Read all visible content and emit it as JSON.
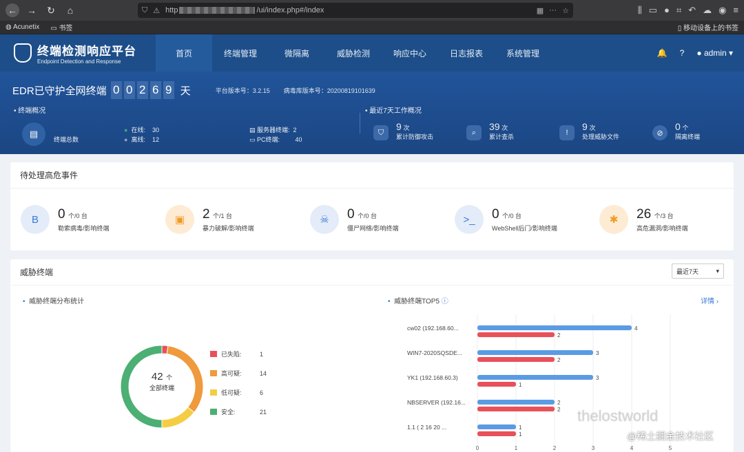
{
  "browser": {
    "url_prefix": "http",
    "url_suffix": "/ui/index.php#/index",
    "bookmark_1": "Acunetix",
    "bookmark_2": "书签",
    "bookmark_right": "移动设备上的书签"
  },
  "nav": {
    "title": "终端检测响应平台",
    "subtitle": "Endpoint Detection and Response",
    "items": [
      "首页",
      "终端管理",
      "微隔离",
      "威胁检测",
      "响应中心",
      "日志报表",
      "系统管理"
    ],
    "user": "admin"
  },
  "hero": {
    "guard_text": "EDR已守护全网终端",
    "days": [
      "0",
      "0",
      "2",
      "6",
      "9"
    ],
    "day_unit": "天",
    "platform_version": "平台版本号：3.2.15",
    "virus_version": "病毒库版本号：20200819101639",
    "overview_title": "终端概况",
    "total_label": "终端总数",
    "online_label": "在线:",
    "online": "30",
    "offline_label": "离线:",
    "offline": "12",
    "server_label": "服务器终端:",
    "server": "2",
    "pc_label": "PC终端:",
    "pc": "40",
    "week_title": "最近7天工作概况",
    "week": [
      {
        "value": "9",
        "unit": "次",
        "label": "累计防御攻击"
      },
      {
        "value": "39",
        "unit": "次",
        "label": "累计查杀"
      },
      {
        "value": "9",
        "unit": "次",
        "label": "处理威胁文件"
      },
      {
        "value": "0",
        "unit": "个",
        "label": "隔离终端"
      }
    ]
  },
  "pending": {
    "title": "待处理高危事件",
    "items": [
      {
        "value": "0",
        "unit": "个/0 台",
        "label": "勒索病毒/影响终端",
        "color": "#e3ecf8",
        "fg": "#3a79d6",
        "icon": "B"
      },
      {
        "value": "2",
        "unit": "个/1 台",
        "label": "暴力破解/影响终端",
        "color": "#fdebd3",
        "fg": "#f09a24",
        "icon": "▣"
      },
      {
        "value": "0",
        "unit": "个/0 台",
        "label": "僵尸网络/影响终端",
        "color": "#e3ecf8",
        "fg": "#3a79d6",
        "icon": "☠"
      },
      {
        "value": "0",
        "unit": "个/0 台",
        "label": "WebShell后门/影响终端",
        "color": "#e3ecf8",
        "fg": "#3a79d6",
        "icon": ">_"
      },
      {
        "value": "26",
        "unit": "个/3 台",
        "label": "高危漏洞/影响终端",
        "color": "#fdebd3",
        "fg": "#f09a24",
        "icon": "✱"
      }
    ]
  },
  "threat": {
    "title": "威胁终端",
    "range": "最近7天",
    "dist_title": "威胁终端分布统计",
    "top_title": "威胁终端TOP5",
    "detail": "详情",
    "donut_total": "42",
    "donut_unit": "个",
    "donut_label": "全部终端"
  },
  "chart_data": [
    {
      "type": "pie",
      "title": "威胁终端分布统计",
      "categories": [
        "已失陷:",
        "高可疑:",
        "低可疑:",
        "安全:"
      ],
      "values": [
        1,
        14,
        6,
        21
      ],
      "colors": [
        "#e8515a",
        "#ef9a3c",
        "#f5cd44",
        "#4caf73"
      ]
    },
    {
      "type": "bar",
      "title": "威胁终端TOP5",
      "categories": [
        "cw02 (192.168.60...",
        "WIN7-2020SQSDE...",
        "YK1 (192.168.60.3)",
        "NBSERVER (192.16...",
        "1.1 ( 2 16 20 ..."
      ],
      "series": [
        {
          "values": [
            4,
            3,
            3,
            2,
            1
          ],
          "color": "#5b9be3"
        },
        {
          "values": [
            2,
            2,
            1,
            2,
            1
          ],
          "color": "#e8515a"
        }
      ],
      "xticks": [
        "0",
        "1",
        "2",
        "3",
        "4",
        "5"
      ],
      "xlim": [
        0,
        5
      ]
    }
  ],
  "watermark": {
    "w1": "thelostworld",
    "w2": "@稀土掘金技术社区"
  }
}
